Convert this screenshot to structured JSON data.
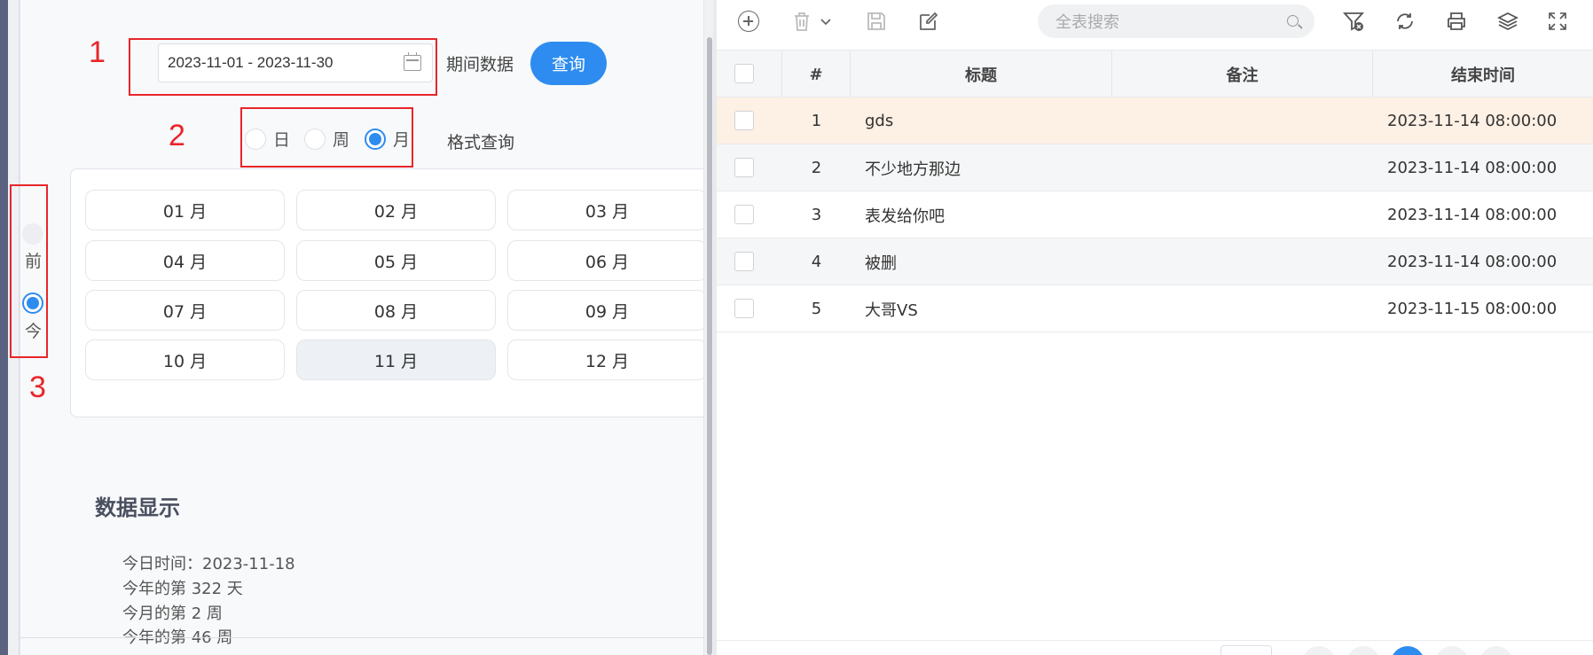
{
  "annotations": [
    "1",
    "2",
    "3"
  ],
  "filter": {
    "date_range": "2023-11-01 - 2023-11-30",
    "period_label": "期间数据",
    "query_button": "查询",
    "format_options": [
      "日",
      "周",
      "月"
    ],
    "format_selected": "月",
    "format_label": "格式查询"
  },
  "months": [
    "01 月",
    "02 月",
    "03 月",
    "04 月",
    "05 月",
    "06 月",
    "07 月",
    "08 月",
    "09 月",
    "10 月",
    "11 月",
    "12 月"
  ],
  "month_selected": "11 月",
  "side_toggle": {
    "prev": "前",
    "current": "今",
    "selected": "今"
  },
  "data_display": {
    "title": "数据显示",
    "lines": [
      "今日时间：2023-11-18",
      "今年的第 322 天",
      "今月的第 2 周",
      "今年的第 46 周"
    ]
  },
  "toolbar": {
    "search_placeholder": "全表搜索",
    "icons": [
      "add-icon",
      "delete-icon",
      "chevron-down-icon",
      "save-icon",
      "edit-icon",
      "filter-clear-icon",
      "refresh-icon",
      "print-icon",
      "layers-icon",
      "fullscreen-icon"
    ]
  },
  "grid": {
    "headers": {
      "index": "#",
      "title": "标题",
      "note": "备注",
      "end_time": "结束时间"
    },
    "rows": [
      {
        "index": "1",
        "title": "gds",
        "note": "",
        "end_time": "2023-11-14 08:00:00"
      },
      {
        "index": "2",
        "title": "不少地方那边",
        "note": "",
        "end_time": "2023-11-14 08:00:00"
      },
      {
        "index": "3",
        "title": "表发给你吧",
        "note": "",
        "end_time": "2023-11-14 08:00:00"
      },
      {
        "index": "4",
        "title": "被删",
        "note": "",
        "end_time": "2023-11-14 08:00:00"
      },
      {
        "index": "5",
        "title": "大哥VS",
        "note": "",
        "end_time": "2023-11-15 08:00:00"
      }
    ]
  },
  "colors": {
    "accent": "#2e8cf0",
    "annotation": "#e8262a",
    "row_highlight": "#fdf0e4"
  }
}
